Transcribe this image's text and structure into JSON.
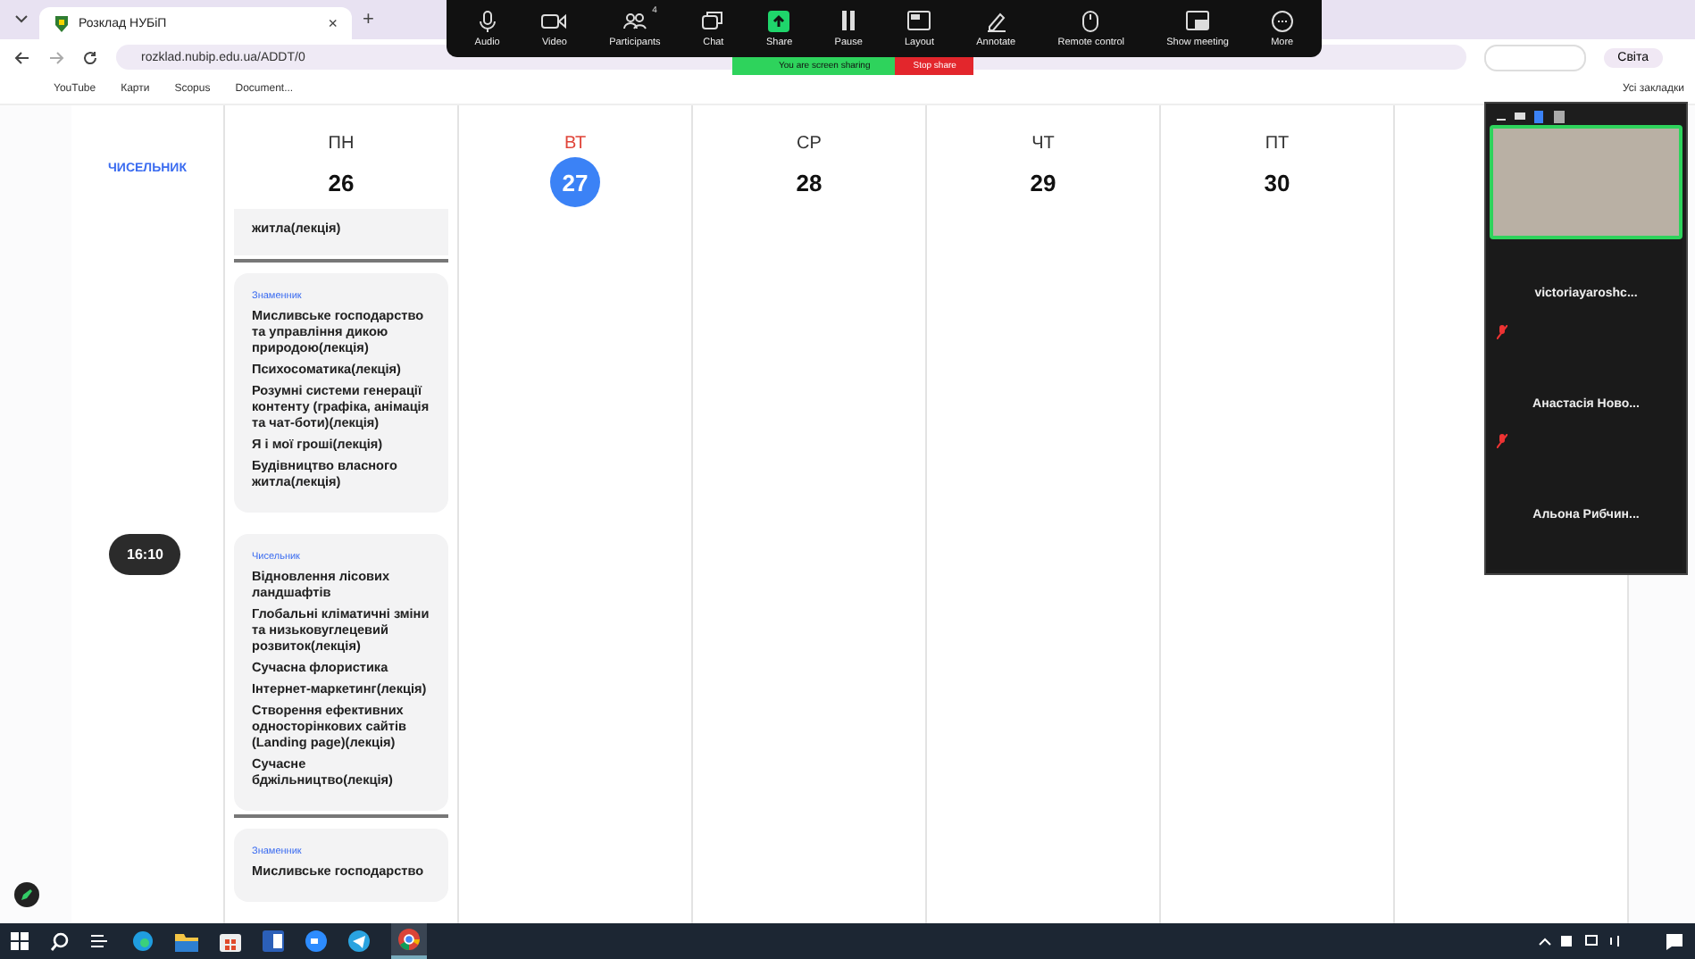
{
  "browser": {
    "tab_title": "Розклад НУБіП",
    "tab_close": "×",
    "new_tab": "+",
    "address": "rozklad.nubip.edu.ua/ADDT/0",
    "profile": "Світа",
    "bookmarks": [
      "YouTube",
      "Карти",
      "Scopus",
      "Document..."
    ],
    "all_bookmarks": "Усі закладки"
  },
  "zoom_toolbar": {
    "buttons": [
      {
        "kind": "audio",
        "label": "Audio"
      },
      {
        "kind": "video",
        "label": "Video"
      },
      {
        "kind": "participants",
        "label": "Participants",
        "badge": "4"
      },
      {
        "kind": "chat",
        "label": "Chat"
      },
      {
        "kind": "share",
        "label": "Share"
      },
      {
        "kind": "pause",
        "label": "Pause"
      },
      {
        "kind": "layout",
        "label": "Layout"
      },
      {
        "kind": "annotate",
        "label": "Annotate"
      },
      {
        "kind": "remote",
        "label": "Remote control"
      },
      {
        "kind": "meeting",
        "label": "Show meeting"
      },
      {
        "kind": "more",
        "label": "More"
      }
    ],
    "banner": "You are screen sharing",
    "stop": "Stop share"
  },
  "schedule": {
    "week_label": "ЧИСЕЛЬНИК",
    "days": [
      {
        "name": "ПН",
        "date": "26",
        "selected": false
      },
      {
        "name": "ВТ",
        "date": "27",
        "selected": true
      },
      {
        "name": "СР",
        "date": "28",
        "selected": false
      },
      {
        "name": "ЧТ",
        "date": "29",
        "selected": false
      },
      {
        "name": "ПТ",
        "date": "30",
        "selected": false
      }
    ],
    "slots": [
      {
        "cards": [
          {
            "kind": "partial",
            "items": [
              "житла(лекція)"
            ]
          },
          {
            "kind": "full",
            "label": "Знаменник",
            "items": [
              "Мисливське господарство та управління дикою природою(лекція)",
              "Психосоматика(лекція)",
              "Розумні системи генерації контенту (графіка, анімація та чат-боти)(лекція)",
              "Я і мої гроші(лекція)",
              "Будівництво власного житла(лекція)"
            ]
          }
        ]
      },
      {
        "time": "16:10",
        "cards": [
          {
            "kind": "full",
            "label": "Чисельник",
            "items": [
              "Відновлення лісових ландшафтів",
              "Глобальні кліматичні зміни та низьковуглецевий розвиток(лекція)",
              "Сучасна флористика",
              "Інтернет-маркетинг(лекція)",
              "Створення ефективних односторінкових сайтів (Landing page)(лекція)",
              "Сучасне бджільництво(лекція)"
            ]
          },
          {
            "kind": "full",
            "label": "Знаменник",
            "items": [
              "Мисливське господарство"
            ]
          }
        ]
      }
    ]
  },
  "participants": [
    {
      "kind": "video"
    },
    {
      "kind": "name",
      "name": "victoriayaroshc...",
      "muted": true
    },
    {
      "kind": "name",
      "name": "Анастасія Ново...",
      "muted": true
    },
    {
      "kind": "name",
      "name": "Альона Рибчин...",
      "muted": false
    }
  ]
}
